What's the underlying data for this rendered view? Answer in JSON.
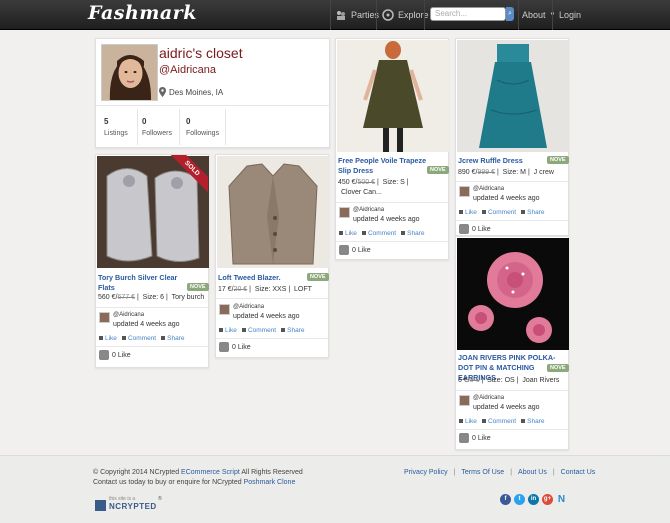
{
  "header": {
    "logo": "Fashmark",
    "nav": [
      {
        "label": "Parties",
        "icon": "parties-icon"
      },
      {
        "label": "Explore",
        "icon": "explore-icon"
      }
    ],
    "search_placeholder": "Search...",
    "about_label": "About",
    "login_label": "Login"
  },
  "profile": {
    "name": "aidric's closet",
    "handle": "@Aidricana",
    "location": "Des Moines, IA",
    "stats": [
      {
        "value": "5",
        "label": "Listings"
      },
      {
        "value": "0",
        "label": "Followers"
      },
      {
        "value": "0",
        "label": "Followings"
      }
    ]
  },
  "listings": [
    {
      "title": "Tory Burch Silver Clear Flats",
      "badge": "NOVE",
      "sold_label": "SOLD",
      "price": "560 €",
      "old_price": "677 €",
      "size": "Size: 6",
      "brand": "Tory burch",
      "user": "@Aidricana",
      "updated": "updated 4 weeks ago",
      "like": "Like",
      "comment": "Comment",
      "share": "Share",
      "likes": "0 Like"
    },
    {
      "title": "Loft Tweed Blazer.",
      "badge": "NOVE",
      "price": "17 €",
      "old_price": "20 €",
      "size": "Size: XXS",
      "brand": "LOFT",
      "user": "@Aidricana",
      "updated": "updated 4 weeks ago",
      "like": "Like",
      "comment": "Comment",
      "share": "Share",
      "likes": "0 Like"
    },
    {
      "title": "Free People Voile Trapeze Slip Dress",
      "badge": "NOVE",
      "price": "450 €",
      "old_price": "500 €",
      "size": "Size: S",
      "brand": "Clover Can...",
      "user": "@Aidricana",
      "updated": "updated 4 weeks ago",
      "like": "Like",
      "comment": "Comment",
      "share": "Share",
      "likes": "0 Like"
    },
    {
      "title": "Jcrew Ruffle Dress",
      "badge": "NOVE",
      "price": "890 €",
      "old_price": "999 €",
      "size": "Size: M",
      "brand": "J crew",
      "user": "@Aidricana",
      "updated": "updated 4 weeks ago",
      "like": "Like",
      "comment": "Comment",
      "share": "Share",
      "likes": "0 Like"
    },
    {
      "title": "JOAN RIVERS PINK POLKA-DOT PIN & MATCHING EARRINGS",
      "badge": "NOVE",
      "price": "6 €",
      "old_price": "8 €",
      "size": "Size: OS",
      "brand": "Joan Rivers",
      "user": "@Aidricana",
      "updated": "updated 4 weeks ago",
      "like": "Like",
      "comment": "Comment",
      "share": "Share",
      "likes": "0 Like"
    }
  ],
  "footer": {
    "copyright_pre": "© Copyright 2014 NCrypted",
    "copyright_link": "ECommerce Script",
    "copyright_post": "All Rights Reserved",
    "contact_pre": "Contact us today to buy or enquire for NCrypted",
    "contact_link": "Poshmark Clone",
    "links": [
      "Privacy Policy",
      "Terms Of Use",
      "About Us",
      "Contact Us"
    ],
    "divider": "|",
    "badge_line1": "this site is a",
    "badge_line2": "NCRYPTED",
    "badge_mark": "®",
    "social": [
      "f",
      "t",
      "in",
      "g+",
      "N"
    ]
  },
  "colors": {
    "accent": "#2a5aa0",
    "sold": "#b3202b",
    "badge": "#8ca87c"
  }
}
